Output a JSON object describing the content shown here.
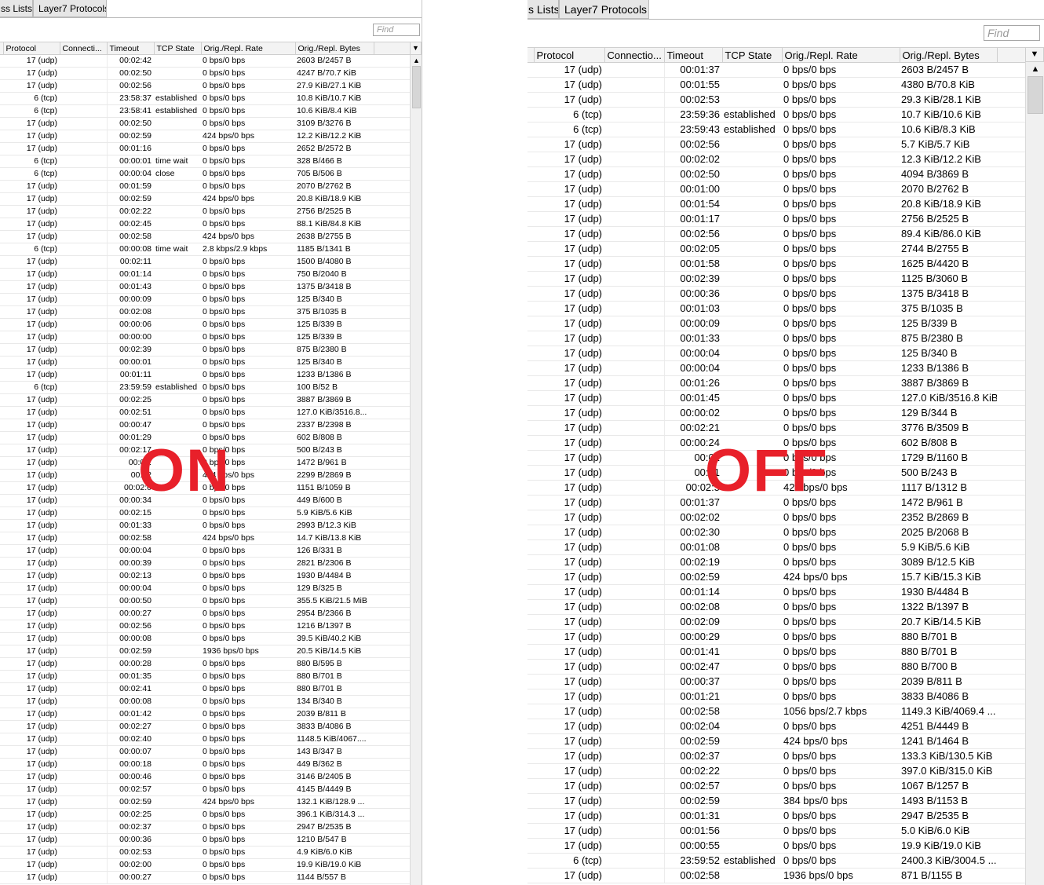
{
  "left": {
    "tabs": [
      "ss Lists",
      "Layer7 Protocols"
    ],
    "find_placeholder": "Find",
    "columns": [
      "Protocol",
      "Connecti...",
      "Timeout",
      "TCP State",
      "Orig./Repl. Rate",
      "Orig./Repl. Bytes"
    ],
    "overlay": "ON",
    "rows": [
      [
        "17 (udp)",
        "00:02:42",
        "",
        "0 bps/0 bps",
        "2603 B/2457 B"
      ],
      [
        "17 (udp)",
        "00:02:50",
        "",
        "0 bps/0 bps",
        "4247 B/70.7 KiB"
      ],
      [
        "17 (udp)",
        "00:02:56",
        "",
        "0 bps/0 bps",
        "27.9 KiB/27.1 KiB"
      ],
      [
        "6 (tcp)",
        "23:58:37",
        "established",
        "0 bps/0 bps",
        "10.8 KiB/10.7 KiB"
      ],
      [
        "6 (tcp)",
        "23:58:41",
        "established",
        "0 bps/0 bps",
        "10.6 KiB/8.4 KiB"
      ],
      [
        "17 (udp)",
        "00:02:50",
        "",
        "0 bps/0 bps",
        "3109 B/3276 B"
      ],
      [
        "17 (udp)",
        "00:02:59",
        "",
        "424 bps/0 bps",
        "12.2 KiB/12.2 KiB"
      ],
      [
        "17 (udp)",
        "00:01:16",
        "",
        "0 bps/0 bps",
        "2652 B/2572 B"
      ],
      [
        "6 (tcp)",
        "00:00:01",
        "time wait",
        "0 bps/0 bps",
        "328 B/466 B"
      ],
      [
        "6 (tcp)",
        "00:00:04",
        "close",
        "0 bps/0 bps",
        "705 B/506 B"
      ],
      [
        "17 (udp)",
        "00:01:59",
        "",
        "0 bps/0 bps",
        "2070 B/2762 B"
      ],
      [
        "17 (udp)",
        "00:02:59",
        "",
        "424 bps/0 bps",
        "20.8 KiB/18.9 KiB"
      ],
      [
        "17 (udp)",
        "00:02:22",
        "",
        "0 bps/0 bps",
        "2756 B/2525 B"
      ],
      [
        "17 (udp)",
        "00:02:45",
        "",
        "0 bps/0 bps",
        "88.1 KiB/84.8 KiB"
      ],
      [
        "17 (udp)",
        "00:02:58",
        "",
        "424 bps/0 bps",
        "2638 B/2755 B"
      ],
      [
        "6 (tcp)",
        "00:00:08",
        "time wait",
        "2.8 kbps/2.9 kbps",
        "1185 B/1341 B"
      ],
      [
        "17 (udp)",
        "00:02:11",
        "",
        "0 bps/0 bps",
        "1500 B/4080 B"
      ],
      [
        "17 (udp)",
        "00:01:14",
        "",
        "0 bps/0 bps",
        "750 B/2040 B"
      ],
      [
        "17 (udp)",
        "00:01:43",
        "",
        "0 bps/0 bps",
        "1375 B/3418 B"
      ],
      [
        "17 (udp)",
        "00:00:09",
        "",
        "0 bps/0 bps",
        "125 B/340 B"
      ],
      [
        "17 (udp)",
        "00:02:08",
        "",
        "0 bps/0 bps",
        "375 B/1035 B"
      ],
      [
        "17 (udp)",
        "00:00:06",
        "",
        "0 bps/0 bps",
        "125 B/339 B"
      ],
      [
        "17 (udp)",
        "00:00:00",
        "",
        "0 bps/0 bps",
        "125 B/339 B"
      ],
      [
        "17 (udp)",
        "00:02:39",
        "",
        "0 bps/0 bps",
        "875 B/2380 B"
      ],
      [
        "17 (udp)",
        "00:00:01",
        "",
        "0 bps/0 bps",
        "125 B/340 B"
      ],
      [
        "17 (udp)",
        "00:01:11",
        "",
        "0 bps/0 bps",
        "1233 B/1386 B"
      ],
      [
        "6 (tcp)",
        "23:59:59",
        "established",
        "0 bps/0 bps",
        "100 B/52 B"
      ],
      [
        "17 (udp)",
        "00:02:25",
        "",
        "0 bps/0 bps",
        "3887 B/3869 B"
      ],
      [
        "17 (udp)",
        "00:02:51",
        "",
        "0 bps/0 bps",
        "127.0 KiB/3516.8..."
      ],
      [
        "17 (udp)",
        "00:00:47",
        "",
        "0 bps/0 bps",
        "2337 B/2398 B"
      ],
      [
        "17 (udp)",
        "00:01:29",
        "",
        "0 bps/0 bps",
        "602 B/808 B"
      ],
      [
        "17 (udp)",
        "00:02:17",
        "",
        "0 bps/0 bps",
        "500 B/243 B"
      ],
      [
        "17 (udp)",
        "00:02:",
        "",
        "0 bps/0 bps",
        "1472 B/961 B"
      ],
      [
        "17 (udp)",
        "00:02",
        "",
        "424 bps/0 bps",
        "2299 B/2869 B"
      ],
      [
        "17 (udp)",
        "00:02:0",
        "",
        "0 bps/0 bps",
        "1151 B/1059 B"
      ],
      [
        "17 (udp)",
        "00:00:34",
        "",
        "0 bps/0 bps",
        "449 B/600 B"
      ],
      [
        "17 (udp)",
        "00:02:15",
        "",
        "0 bps/0 bps",
        "5.9 KiB/5.6 KiB"
      ],
      [
        "17 (udp)",
        "00:01:33",
        "",
        "0 bps/0 bps",
        "2993 B/12.3 KiB"
      ],
      [
        "17 (udp)",
        "00:02:58",
        "",
        "424 bps/0 bps",
        "14.7 KiB/13.8 KiB"
      ],
      [
        "17 (udp)",
        "00:00:04",
        "",
        "0 bps/0 bps",
        "126 B/331 B"
      ],
      [
        "17 (udp)",
        "00:00:39",
        "",
        "0 bps/0 bps",
        "2821 B/2306 B"
      ],
      [
        "17 (udp)",
        "00:02:13",
        "",
        "0 bps/0 bps",
        "1930 B/4484 B"
      ],
      [
        "17 (udp)",
        "00:00:04",
        "",
        "0 bps/0 bps",
        "129 B/325 B"
      ],
      [
        "17 (udp)",
        "00:00:50",
        "",
        "0 bps/0 bps",
        "355.5 KiB/21.5 MiB"
      ],
      [
        "17 (udp)",
        "00:00:27",
        "",
        "0 bps/0 bps",
        "2954 B/2366 B"
      ],
      [
        "17 (udp)",
        "00:02:56",
        "",
        "0 bps/0 bps",
        "1216 B/1397 B"
      ],
      [
        "17 (udp)",
        "00:00:08",
        "",
        "0 bps/0 bps",
        "39.5 KiB/40.2 KiB"
      ],
      [
        "17 (udp)",
        "00:02:59",
        "",
        "1936 bps/0 bps",
        "20.5 KiB/14.5 KiB"
      ],
      [
        "17 (udp)",
        "00:00:28",
        "",
        "0 bps/0 bps",
        "880 B/595 B"
      ],
      [
        "17 (udp)",
        "00:01:35",
        "",
        "0 bps/0 bps",
        "880 B/701 B"
      ],
      [
        "17 (udp)",
        "00:02:41",
        "",
        "0 bps/0 bps",
        "880 B/701 B"
      ],
      [
        "17 (udp)",
        "00:00:08",
        "",
        "0 bps/0 bps",
        "134 B/340 B"
      ],
      [
        "17 (udp)",
        "00:01:42",
        "",
        "0 bps/0 bps",
        "2039 B/811 B"
      ],
      [
        "17 (udp)",
        "00:02:27",
        "",
        "0 bps/0 bps",
        "3833 B/4086 B"
      ],
      [
        "17 (udp)",
        "00:02:40",
        "",
        "0 bps/0 bps",
        "1148.5 KiB/4067...."
      ],
      [
        "17 (udp)",
        "00:00:07",
        "",
        "0 bps/0 bps",
        "143 B/347 B"
      ],
      [
        "17 (udp)",
        "00:00:18",
        "",
        "0 bps/0 bps",
        "449 B/362 B"
      ],
      [
        "17 (udp)",
        "00:00:46",
        "",
        "0 bps/0 bps",
        "3146 B/2405 B"
      ],
      [
        "17 (udp)",
        "00:02:57",
        "",
        "0 bps/0 bps",
        "4145 B/4449 B"
      ],
      [
        "17 (udp)",
        "00:02:59",
        "",
        "424 bps/0 bps",
        "132.1 KiB/128.9 ..."
      ],
      [
        "17 (udp)",
        "00:02:25",
        "",
        "0 bps/0 bps",
        "396.1 KiB/314.3 ..."
      ],
      [
        "17 (udp)",
        "00:02:37",
        "",
        "0 bps/0 bps",
        "2947 B/2535 B"
      ],
      [
        "17 (udp)",
        "00:00:36",
        "",
        "0 bps/0 bps",
        "1210 B/547 B"
      ],
      [
        "17 (udp)",
        "00:02:53",
        "",
        "0 bps/0 bps",
        "4.9 KiB/6.0 KiB"
      ],
      [
        "17 (udp)",
        "00:02:00",
        "",
        "0 bps/0 bps",
        "19.9 KiB/19.0 KiB"
      ],
      [
        "17 (udp)",
        "00:00:27",
        "",
        "0 bps/0 bps",
        "1144 B/557 B"
      ]
    ]
  },
  "right": {
    "tabs": [
      "s Lists",
      "Layer7 Protocols"
    ],
    "find_placeholder": "Find",
    "columns": [
      "Protocol",
      "Connectio...",
      "Timeout",
      "TCP State",
      "Orig./Repl. Rate",
      "Orig./Repl. Bytes"
    ],
    "overlay": "OFF",
    "rows": [
      [
        "17 (udp)",
        "00:01:37",
        "",
        "0 bps/0 bps",
        "2603 B/2457 B"
      ],
      [
        "17 (udp)",
        "00:01:55",
        "",
        "0 bps/0 bps",
        "4380 B/70.8 KiB"
      ],
      [
        "17 (udp)",
        "00:02:53",
        "",
        "0 bps/0 bps",
        "29.3 KiB/28.1 KiB"
      ],
      [
        "6 (tcp)",
        "23:59:36",
        "established",
        "0 bps/0 bps",
        "10.7 KiB/10.6 KiB"
      ],
      [
        "6 (tcp)",
        "23:59:43",
        "established",
        "0 bps/0 bps",
        "10.6 KiB/8.3 KiB"
      ],
      [
        "17 (udp)",
        "00:02:56",
        "",
        "0 bps/0 bps",
        "5.7 KiB/5.7 KiB"
      ],
      [
        "17 (udp)",
        "00:02:02",
        "",
        "0 bps/0 bps",
        "12.3 KiB/12.2 KiB"
      ],
      [
        "17 (udp)",
        "00:02:50",
        "",
        "0 bps/0 bps",
        "4094 B/3869 B"
      ],
      [
        "17 (udp)",
        "00:01:00",
        "",
        "0 bps/0 bps",
        "2070 B/2762 B"
      ],
      [
        "17 (udp)",
        "00:01:54",
        "",
        "0 bps/0 bps",
        "20.8 KiB/18.9 KiB"
      ],
      [
        "17 (udp)",
        "00:01:17",
        "",
        "0 bps/0 bps",
        "2756 B/2525 B"
      ],
      [
        "17 (udp)",
        "00:02:56",
        "",
        "0 bps/0 bps",
        "89.4 KiB/86.0 KiB"
      ],
      [
        "17 (udp)",
        "00:02:05",
        "",
        "0 bps/0 bps",
        "2744 B/2755 B"
      ],
      [
        "17 (udp)",
        "00:01:58",
        "",
        "0 bps/0 bps",
        "1625 B/4420 B"
      ],
      [
        "17 (udp)",
        "00:02:39",
        "",
        "0 bps/0 bps",
        "1125 B/3060 B"
      ],
      [
        "17 (udp)",
        "00:00:36",
        "",
        "0 bps/0 bps",
        "1375 B/3418 B"
      ],
      [
        "17 (udp)",
        "00:01:03",
        "",
        "0 bps/0 bps",
        "375 B/1035 B"
      ],
      [
        "17 (udp)",
        "00:00:09",
        "",
        "0 bps/0 bps",
        "125 B/339 B"
      ],
      [
        "17 (udp)",
        "00:01:33",
        "",
        "0 bps/0 bps",
        "875 B/2380 B"
      ],
      [
        "17 (udp)",
        "00:00:04",
        "",
        "0 bps/0 bps",
        "125 B/340 B"
      ],
      [
        "17 (udp)",
        "00:00:04",
        "",
        "0 bps/0 bps",
        "1233 B/1386 B"
      ],
      [
        "17 (udp)",
        "00:01:26",
        "",
        "0 bps/0 bps",
        "3887 B/3869 B"
      ],
      [
        "17 (udp)",
        "00:01:45",
        "",
        "0 bps/0 bps",
        "127.0 KiB/3516.8 KiB"
      ],
      [
        "17 (udp)",
        "00:00:02",
        "",
        "0 bps/0 bps",
        "129 B/344 B"
      ],
      [
        "17 (udp)",
        "00:02:21",
        "",
        "0 bps/0 bps",
        "3776 B/3509 B"
      ],
      [
        "17 (udp)",
        "00:00:24",
        "",
        "0 bps/0 bps",
        "602 B/808 B"
      ],
      [
        "17 (udp)",
        "00:02",
        "",
        "0 bps/0 bps",
        "1729 B/1160 B"
      ],
      [
        "17 (udp)",
        "00:01",
        "",
        "0 bps/0 bps",
        "500 B/243 B"
      ],
      [
        "17 (udp)",
        "00:02:5",
        "",
        "424 bps/0 bps",
        "1117 B/1312 B"
      ],
      [
        "17 (udp)",
        "00:01:37",
        "",
        "0 bps/0 bps",
        "1472 B/961 B"
      ],
      [
        "17 (udp)",
        "00:02:02",
        "",
        "0 bps/0 bps",
        "2352 B/2869 B"
      ],
      [
        "17 (udp)",
        "00:02:30",
        "",
        "0 bps/0 bps",
        "2025 B/2068 B"
      ],
      [
        "17 (udp)",
        "00:01:08",
        "",
        "0 bps/0 bps",
        "5.9 KiB/5.6 KiB"
      ],
      [
        "17 (udp)",
        "00:02:19",
        "",
        "0 bps/0 bps",
        "3089 B/12.5 KiB"
      ],
      [
        "17 (udp)",
        "00:02:59",
        "",
        "424 bps/0 bps",
        "15.7 KiB/15.3 KiB"
      ],
      [
        "17 (udp)",
        "00:01:14",
        "",
        "0 bps/0 bps",
        "1930 B/4484 B"
      ],
      [
        "17 (udp)",
        "00:02:08",
        "",
        "0 bps/0 bps",
        "1322 B/1397 B"
      ],
      [
        "17 (udp)",
        "00:02:09",
        "",
        "0 bps/0 bps",
        "20.7 KiB/14.5 KiB"
      ],
      [
        "17 (udp)",
        "00:00:29",
        "",
        "0 bps/0 bps",
        "880 B/701 B"
      ],
      [
        "17 (udp)",
        "00:01:41",
        "",
        "0 bps/0 bps",
        "880 B/701 B"
      ],
      [
        "17 (udp)",
        "00:02:47",
        "",
        "0 bps/0 bps",
        "880 B/700 B"
      ],
      [
        "17 (udp)",
        "00:00:37",
        "",
        "0 bps/0 bps",
        "2039 B/811 B"
      ],
      [
        "17 (udp)",
        "00:01:21",
        "",
        "0 bps/0 bps",
        "3833 B/4086 B"
      ],
      [
        "17 (udp)",
        "00:02:58",
        "",
        "1056 bps/2.7 kbps",
        "1149.3 KiB/4069.4 ..."
      ],
      [
        "17 (udp)",
        "00:02:04",
        "",
        "0 bps/0 bps",
        "4251 B/4449 B"
      ],
      [
        "17 (udp)",
        "00:02:59",
        "",
        "424 bps/0 bps",
        "1241 B/1464 B"
      ],
      [
        "17 (udp)",
        "00:02:37",
        "",
        "0 bps/0 bps",
        "133.3 KiB/130.5 KiB"
      ],
      [
        "17 (udp)",
        "00:02:22",
        "",
        "0 bps/0 bps",
        "397.0 KiB/315.0 KiB"
      ],
      [
        "17 (udp)",
        "00:02:57",
        "",
        "0 bps/0 bps",
        "1067 B/1257 B"
      ],
      [
        "17 (udp)",
        "00:02:59",
        "",
        "384 bps/0 bps",
        "1493 B/1153 B"
      ],
      [
        "17 (udp)",
        "00:01:31",
        "",
        "0 bps/0 bps",
        "2947 B/2535 B"
      ],
      [
        "17 (udp)",
        "00:01:56",
        "",
        "0 bps/0 bps",
        "5.0 KiB/6.0 KiB"
      ],
      [
        "17 (udp)",
        "00:00:55",
        "",
        "0 bps/0 bps",
        "19.9 KiB/19.0 KiB"
      ],
      [
        "6 (tcp)",
        "23:59:52",
        "established",
        "0 bps/0 bps",
        "2400.3 KiB/3004.5 ..."
      ],
      [
        "17 (udp)",
        "00:02:58",
        "",
        "1936 bps/0 bps",
        "871 B/1155 B"
      ]
    ]
  },
  "colors": {
    "overlay_red": "#e8202a",
    "header_bg": "#f3f3f3"
  }
}
